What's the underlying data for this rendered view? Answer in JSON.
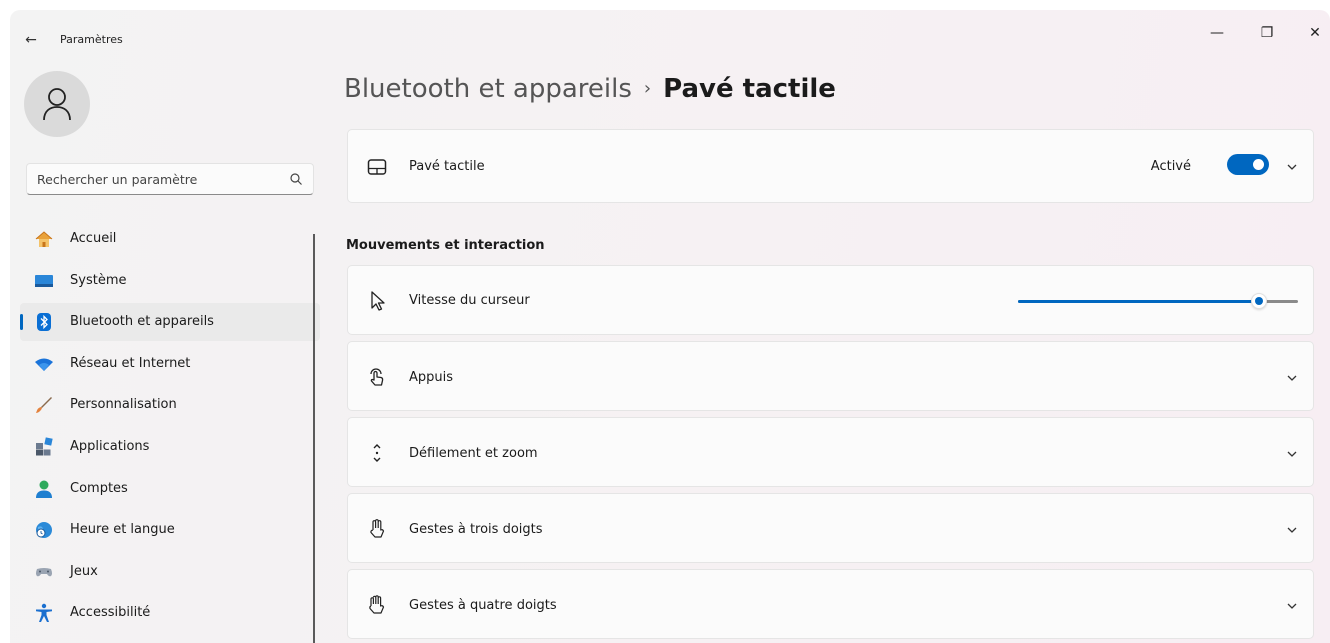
{
  "window": {
    "title": "Paramètres",
    "back": "←",
    "minimize": "—",
    "maximize": "❐",
    "close": "✕"
  },
  "sidebar": {
    "search_placeholder": "Rechercher un paramètre",
    "items": [
      {
        "label": "Accueil",
        "icon": "home-icon"
      },
      {
        "label": "Système",
        "icon": "system-icon"
      },
      {
        "label": "Bluetooth et appareils",
        "icon": "bluetooth-icon",
        "selected": true
      },
      {
        "label": "Réseau et Internet",
        "icon": "wifi-icon"
      },
      {
        "label": "Personnalisation",
        "icon": "brush-icon"
      },
      {
        "label": "Applications",
        "icon": "apps-icon"
      },
      {
        "label": "Comptes",
        "icon": "account-icon"
      },
      {
        "label": "Heure et langue",
        "icon": "globe-clock-icon"
      },
      {
        "label": "Jeux",
        "icon": "gamepad-icon"
      },
      {
        "label": "Accessibilité",
        "icon": "accessibility-icon"
      }
    ]
  },
  "breadcrumb": {
    "parent": "Bluetooth et appareils",
    "separator": "›",
    "current": "Pavé tactile"
  },
  "touchpad_card": {
    "label": "Pavé tactile",
    "status": "Activé",
    "enabled": true
  },
  "section": {
    "title": "Mouvements et interaction"
  },
  "cursor_speed": {
    "label": "Vitesse du curseur",
    "value_fraction": 0.86
  },
  "rows": [
    {
      "label": "Appuis",
      "icon": "tap-icon"
    },
    {
      "label": "Défilement et zoom",
      "icon": "scroll-icon"
    },
    {
      "label": "Gestes à trois doigts",
      "icon": "three-finger-icon"
    },
    {
      "label": "Gestes à quatre doigts",
      "icon": "four-finger-icon"
    }
  ],
  "colors": {
    "accent": "#0067c0"
  }
}
